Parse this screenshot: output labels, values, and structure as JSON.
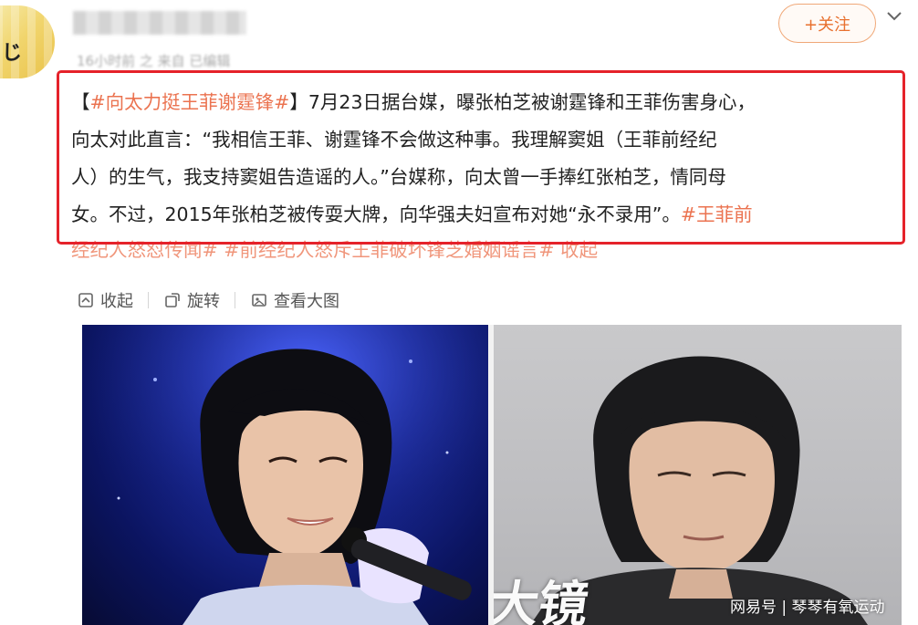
{
  "header": {
    "avatar_glyph": "じ",
    "meta_text": "16小时前 之      来自   已编辑",
    "follow_label": "+关注",
    "menu_icon": "chevron-down-icon"
  },
  "post": {
    "tag_main": "#向太力挺王菲谢霆锋#",
    "line1_text": "7月23日据台媒，曝张柏芝被谢霆锋和王菲伤害身心，",
    "line2_text": "向太对此直言：“我相信王菲、谢霆锋不会做这种事。我理解窦姐（王菲前经纪",
    "line3_text": "人）的生气，我支持窦姐告造谣的人。”台媒称，向太曾一手捧红张柏芝，情同母",
    "line4_text": "女。不过，2015年张柏芝被传耍大牌，向华强夫妇宣布对她“永不录用”。",
    "tag_inline": "#王菲前",
    "line5_tag_a": "经纪人怒怼传闻#",
    "line5_tag_b": "#前经纪人怒斥王菲破坏锋芝婚姻谣言#",
    "line5_collapse": "收起",
    "highlight_color": "#e5222a",
    "tag_color": "#eb7350"
  },
  "actions": {
    "collapse_label": "收起",
    "rotate_label": "旋转",
    "view_large_label": "查看大图"
  },
  "images": {
    "calligraphy_text": "大镜",
    "watermark_text": "网易号 | 琴琴有氧运动"
  }
}
